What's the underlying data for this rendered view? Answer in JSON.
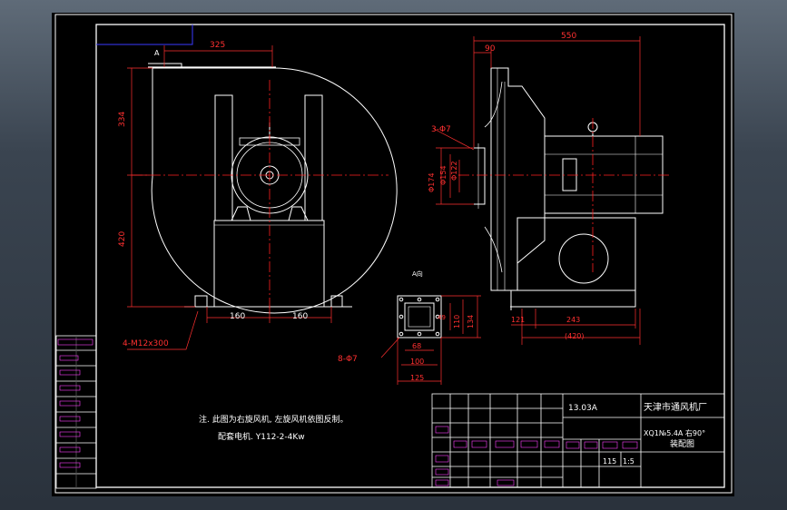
{
  "title_block": {
    "drawing_number": "13.03A",
    "company": "天津市通风机厂",
    "model": "XQ1№5.4A 右90°",
    "drawing_type": "装配图",
    "quantity": "115",
    "scale": "1:5"
  },
  "notes": {
    "line1": "注. 此图为右旋风机, 左旋风机依图反制。",
    "line2": "配套电机. Y112-2-4Kw"
  },
  "view_label": "A向",
  "view_marker": "A",
  "dimensions": {
    "front_top": "325",
    "front_height_upper": "334",
    "front_height_lower": "420",
    "base_left": "160",
    "base_right": "160",
    "anchor_bolts": "4-M12x300",
    "side_total": "550",
    "side_inlet": "90",
    "side_holes": "3-Φ7",
    "dia_174": "Φ174",
    "dia_154": "Φ154",
    "dia_122": "Φ122",
    "side_base_a": "121",
    "side_base_b": "243",
    "side_base_total": "(420)",
    "flange_holes": "8-Φ7",
    "flange_68": "68",
    "flange_100": "100",
    "flange_125": "125",
    "flange_110": "110",
    "flange_134": "134",
    "flange_49": "49"
  },
  "colors": {
    "line": "#ffffff",
    "center": "#ff2020",
    "dim": "#ff3030",
    "text": "#ffffff",
    "text_dim": "#ffffff",
    "border": "#0000ff",
    "magenta": "#ff40ff",
    "blue": "#0000ff"
  }
}
